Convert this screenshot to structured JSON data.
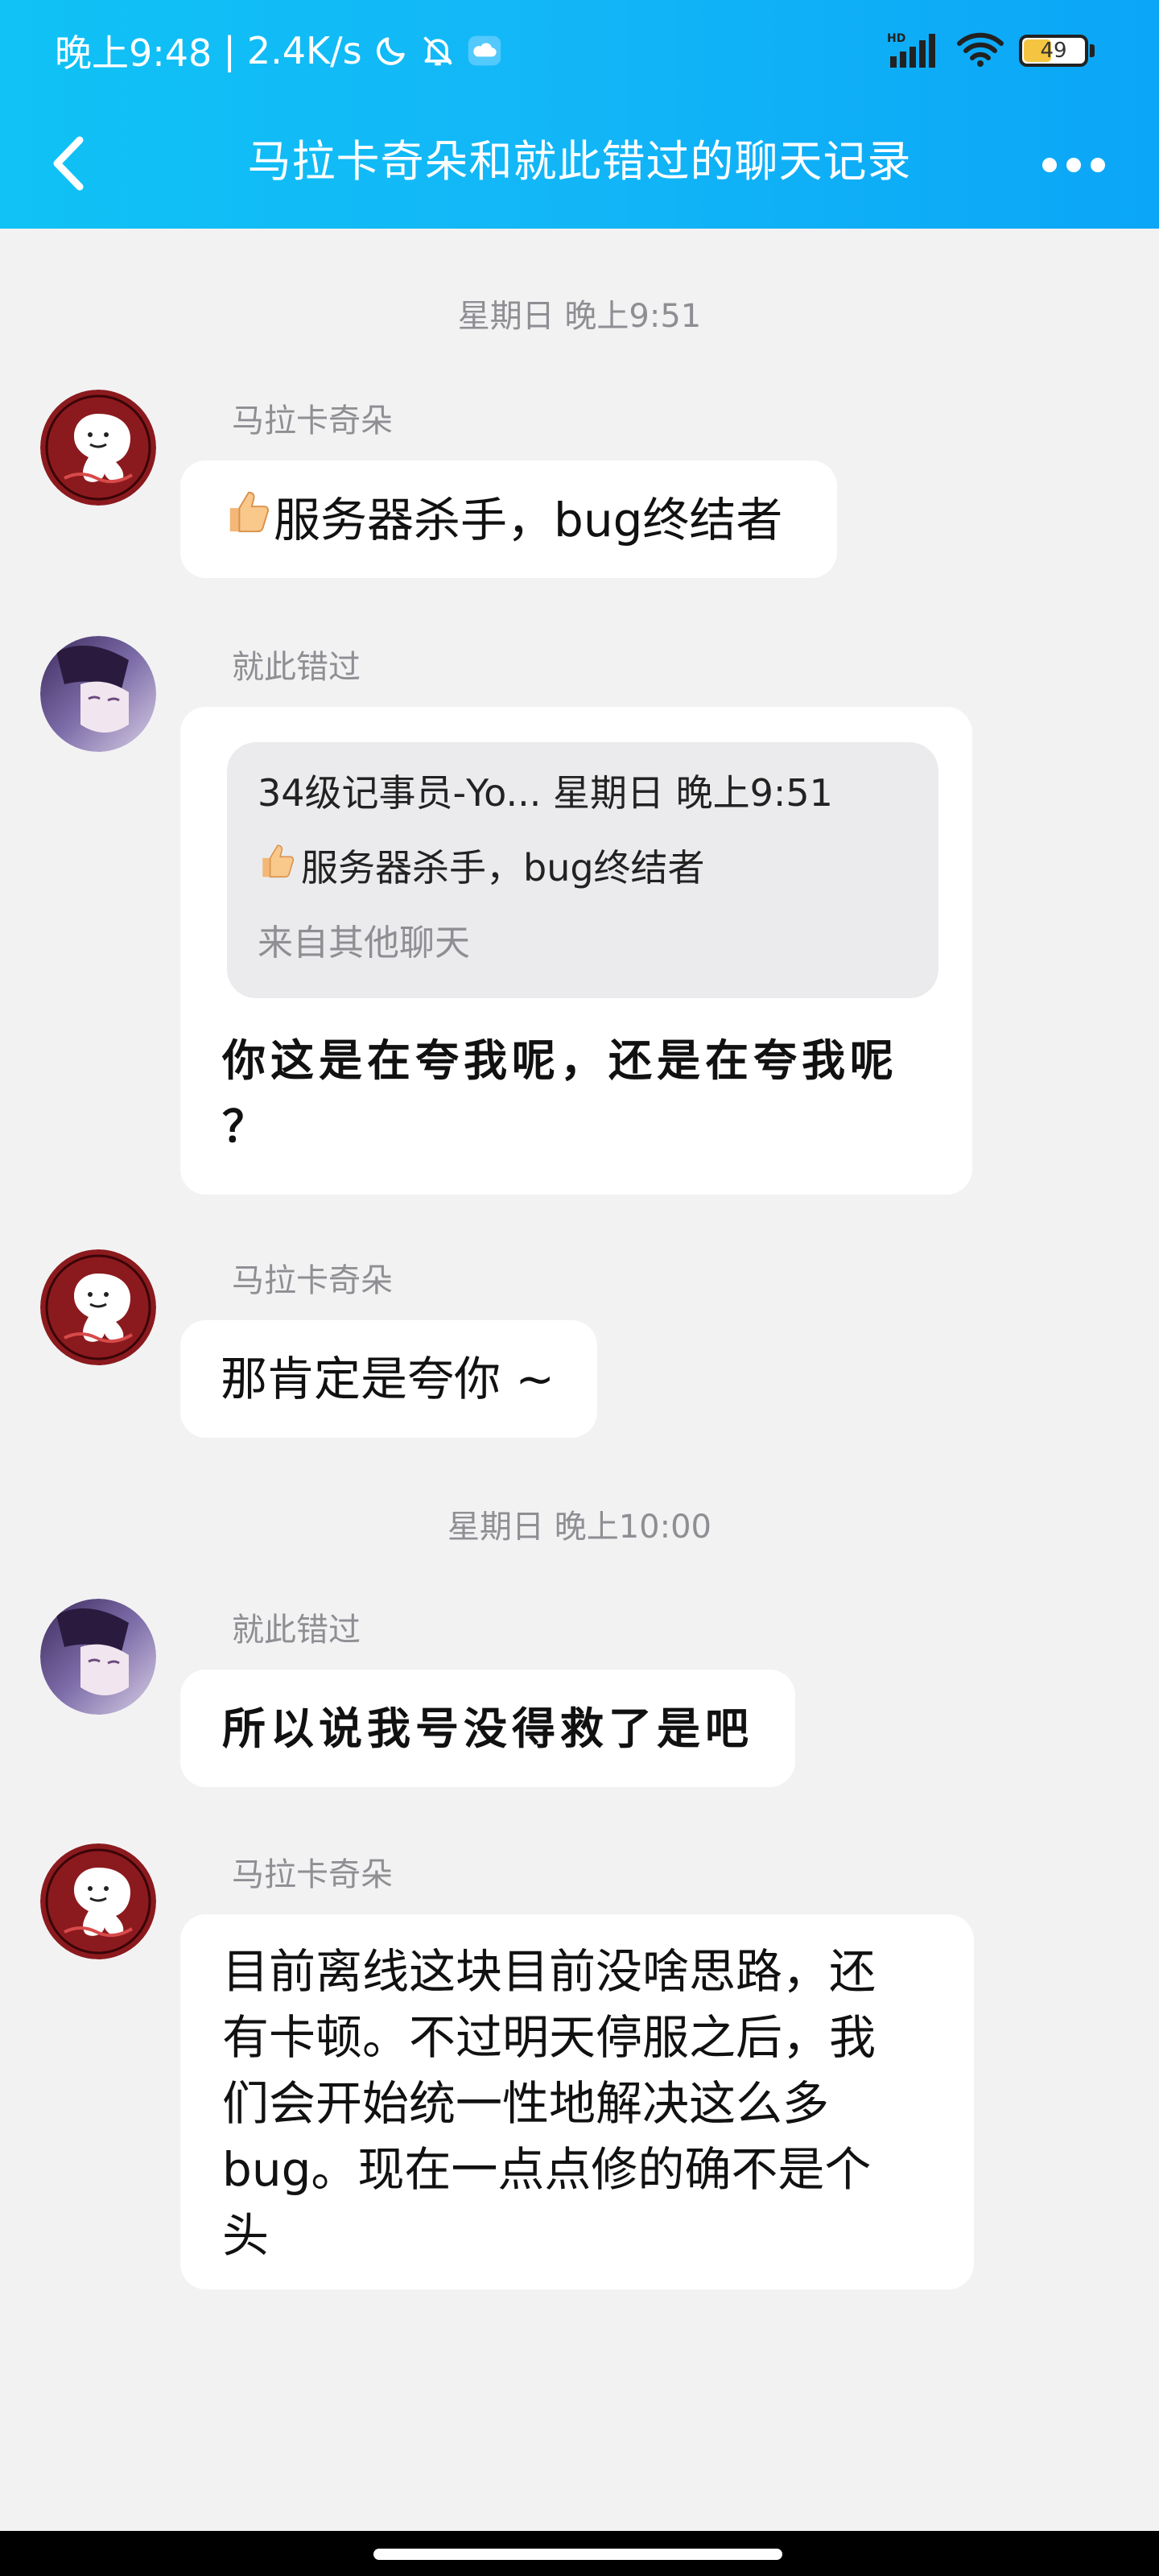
{
  "status_bar": {
    "time": "晚上9:48",
    "separator": "|",
    "speed": "2.4K/s",
    "network": "HD",
    "battery": "49",
    "battery_level": 0.49,
    "icons": [
      "moon-icon",
      "bell-off-icon",
      "cloud-icon",
      "signal-icon",
      "wifi-icon",
      "battery-icon"
    ]
  },
  "nav": {
    "title": "马拉卡奇朵和就此错过的聊天记录",
    "back_icon": "chevron-left-icon",
    "more_icon": "more-dots-icon"
  },
  "chat": {
    "timestamps": [
      "星期日 晚上9:51",
      "星期日 晚上10:00"
    ],
    "messages": [
      {
        "sender": "马拉卡奇朵",
        "text": "服务器杀手，bug终结者",
        "emoji": "thumbs-up-icon"
      },
      {
        "sender": "就此错过",
        "quote": {
          "meta": "34级记事员-Yo... 星期日 晚上9:51",
          "text": "服务器杀手，bug终结者",
          "source": "来自其他聊天"
        },
        "text_line1": "你这是在夸我呢，还是在夸我呢",
        "text_line2": "？"
      },
      {
        "sender": "马拉卡奇朵",
        "text": "那肯定是夸你 ~"
      },
      {
        "sender": "就此错过",
        "text": "所以说我号没得救了是吧"
      },
      {
        "sender": "马拉卡奇朵",
        "lines": [
          "目前离线这块目前没啥思路，还",
          "有卡顿。不过明天停服之后，我",
          "们会开始统一性地解决这么多",
          "bug。现在一点点修的确不是个",
          "头"
        ]
      }
    ]
  },
  "colors": {
    "header_gradient_start": "#10c2f5",
    "header_gradient_end": "#0ba6f7",
    "background": "#f2f2f3",
    "bubble": "#ffffff",
    "quote_bg": "#ebebed",
    "meta_text": "#8e8e93"
  }
}
